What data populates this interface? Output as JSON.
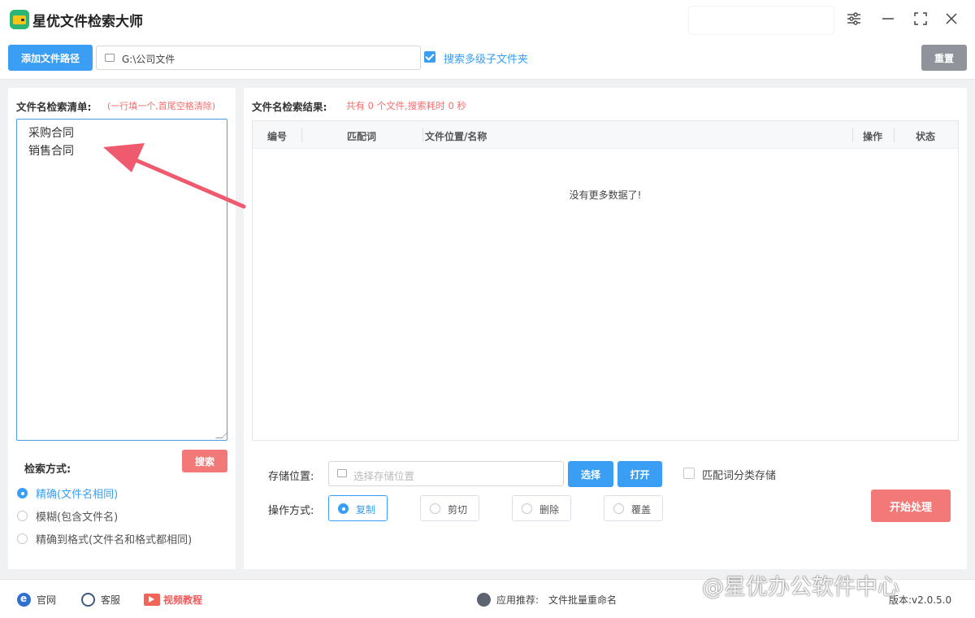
{
  "app": {
    "title": "星优文件检索大师"
  },
  "toolbar": {
    "add_path_label": "添加文件路径",
    "path_value": "G:\\公司文件",
    "search_subfolders_label": "搜索多级子文件夹",
    "reset_label": "重置"
  },
  "left": {
    "list_title": "文件名检索清单:",
    "list_hint": "(一行填一个,首尾空格清除)",
    "list_items": [
      "采购合同",
      "销售合同"
    ],
    "search_mode_label": "检索方式:",
    "search_button": "搜索",
    "modes": [
      "精确(文件名相同)",
      "模糊(包含文件名)",
      "精确到格式(文件名和格式都相同)"
    ]
  },
  "right": {
    "result_title": "文件名检索结果:",
    "result_summary": "共有 0 个文件,搜索耗时 0 秒",
    "columns": [
      "编号",
      "匹配词",
      "文件位置/名称",
      "操作",
      "状态"
    ],
    "empty_text": "没有更多数据了!",
    "storage_label": "存储位置:",
    "storage_placeholder": "选择存储位置",
    "select_button": "选择",
    "open_button": "打开",
    "classify_label": "匹配词分类存储",
    "op_label": "操作方式:",
    "ops": [
      "复制",
      "剪切",
      "删除",
      "覆盖"
    ],
    "start_button": "开始处理"
  },
  "footer": {
    "website": "官网",
    "support": "客服",
    "video": "视频教程",
    "recommend_label": "应用推荐:",
    "recommend_app": "文件批量重命名",
    "version": "版本:v2.0.5.0"
  },
  "watermark": "@星优办公软件中心",
  "colors": {
    "accent": "#3a9ef5",
    "danger": "#f37878",
    "success": "#2bb673",
    "arrow": "#f05a6e"
  }
}
